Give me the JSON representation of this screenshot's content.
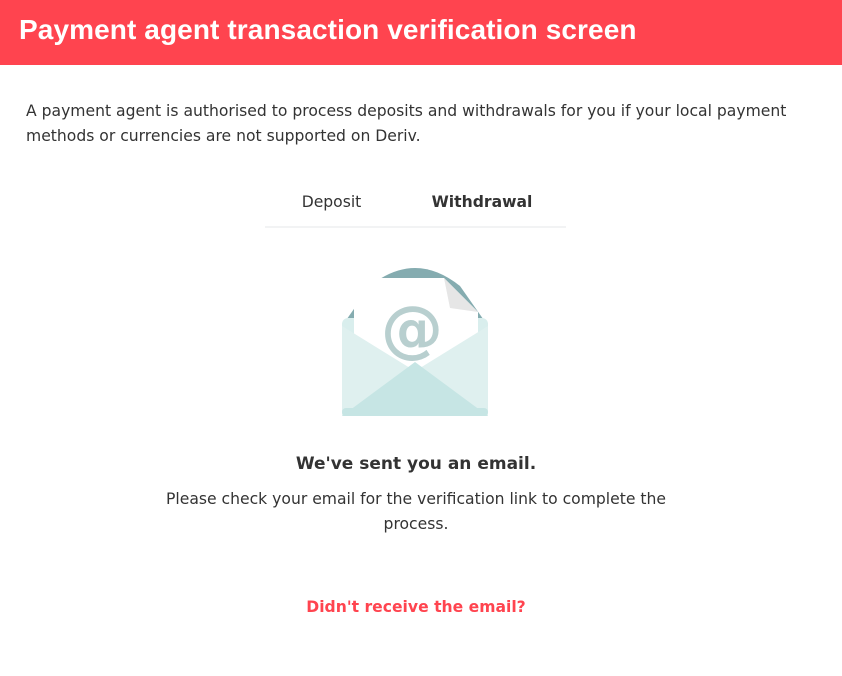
{
  "header": {
    "title": "Payment agent transaction verification screen"
  },
  "intro": {
    "text": "A payment agent is authorised to process deposits and withdrawals for you if your local payment methods or currencies are not supported on Deriv."
  },
  "tabs": [
    {
      "label": "Deposit",
      "active": false
    },
    {
      "label": "Withdrawal",
      "active": true
    }
  ],
  "illustration": {
    "icon": "email-envelope-icon",
    "symbol": "@"
  },
  "message": {
    "title": "We've sent you an email.",
    "description": "Please check your email for the verification link to complete the process."
  },
  "resend": {
    "label": "Didn't receive the email?"
  },
  "colors": {
    "brand": "#ff444f",
    "text": "#333333",
    "envelope_light": "#c6e5e4",
    "envelope_dark": "#85acb0",
    "at_symbol": "#b8cfcf"
  }
}
